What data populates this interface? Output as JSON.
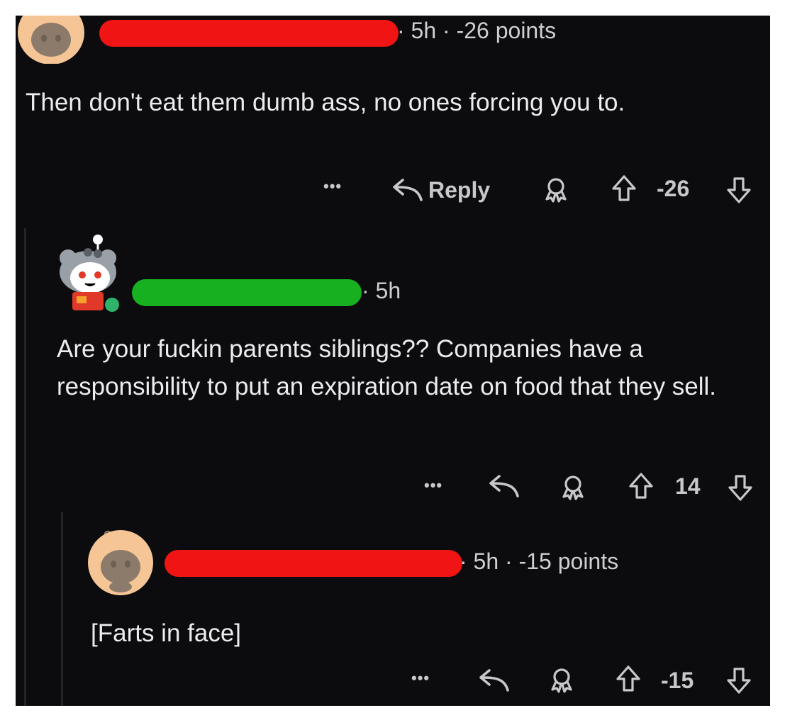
{
  "comments": [
    {
      "meta": "· 5h · -26 points",
      "text": "Then don't eat them dumb ass, no ones forcing you to.",
      "actions": {
        "more": "•••",
        "reply": "Reply",
        "score": "-26"
      },
      "redaction_color": "#f01414",
      "avatar": "snoo-avatar-default"
    },
    {
      "meta": "· 5h",
      "text": "Are your fuckin parents siblings?? Companies have a responsibility to put an expiration date on food that they sell.",
      "actions": {
        "more": "•••",
        "score": "14"
      },
      "redaction_color": "#16b020",
      "avatar": "snoo-avatar-custom",
      "online": true
    },
    {
      "meta": "· 5h · -15 points",
      "text": "[Farts in face]",
      "actions": {
        "more": "•••",
        "score": "-15"
      },
      "redaction_color": "#f01414",
      "avatar": "snoo-avatar-default"
    }
  ],
  "colors": {
    "background": "#0c0c0e",
    "text": "#ececee",
    "muted": "#c8c8cc",
    "avatar_bg": "#f6c595"
  }
}
